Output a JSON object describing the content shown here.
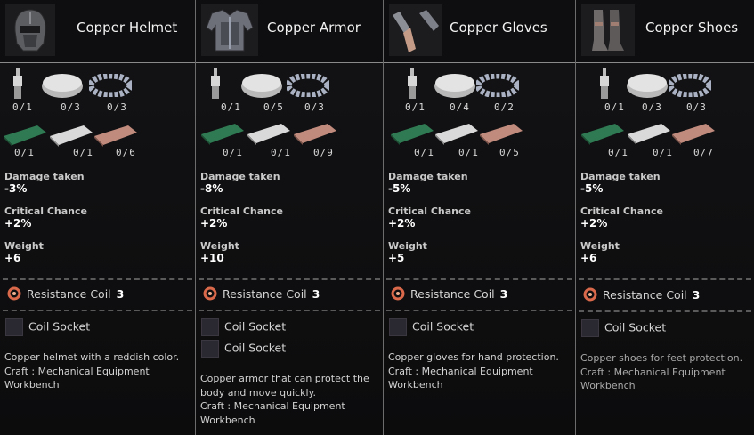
{
  "items": [
    {
      "name": "Copper Helmet",
      "materials": [
        "0/1",
        "0/3",
        "0/3",
        "0/1",
        "0/1",
        "0/6"
      ],
      "stats": [
        {
          "label": "Damage taken",
          "value": "-3%"
        },
        {
          "label": "Critical Chance",
          "value": "+2%"
        },
        {
          "label": "Weight",
          "value": "+6"
        }
      ],
      "coil_label": "Resistance Coil",
      "coil_count": "3",
      "sockets": [
        "Coil Socket"
      ],
      "desc": "Copper helmet with a reddish color.",
      "craft": "Craft : Mechanical Equipment Workbench"
    },
    {
      "name": "Copper Armor",
      "materials": [
        "0/1",
        "0/5",
        "0/3",
        "0/1",
        "0/1",
        "0/9"
      ],
      "stats": [
        {
          "label": "Damage taken",
          "value": "-8%"
        },
        {
          "label": "Critical Chance",
          "value": "+2%"
        },
        {
          "label": "Weight",
          "value": "+10"
        }
      ],
      "coil_label": "Resistance Coil",
      "coil_count": "3",
      "sockets": [
        "Coil Socket",
        "Coil Socket"
      ],
      "desc": "Copper armor that can protect the body and move quickly.",
      "craft": "Craft : Mechanical Equipment Workbench"
    },
    {
      "name": "Copper Gloves",
      "materials": [
        "0/1",
        "0/4",
        "0/2",
        "0/1",
        "0/1",
        "0/5"
      ],
      "stats": [
        {
          "label": "Damage taken",
          "value": "-5%"
        },
        {
          "label": "Critical Chance",
          "value": "+2%"
        },
        {
          "label": "Weight",
          "value": "+5"
        }
      ],
      "coil_label": "Resistance Coil",
      "coil_count": "3",
      "sockets": [
        "Coil Socket"
      ],
      "desc": "Copper gloves for hand protection.",
      "craft": "Craft : Mechanical Equipment Workbench"
    },
    {
      "name": "Copper Shoes",
      "materials": [
        "0/1",
        "0/3",
        "0/3",
        "0/1",
        "0/1",
        "0/7"
      ],
      "stats": [
        {
          "label": "Damage taken",
          "value": "-5%"
        },
        {
          "label": "Critical Chance",
          "value": "+2%"
        },
        {
          "label": "Weight",
          "value": "+6"
        }
      ],
      "coil_label": "Resistance Coil",
      "coil_count": "3",
      "sockets": [
        "Coil Socket"
      ],
      "desc": "Copper shoes for feet protection.",
      "craft": "Craft : Mechanical Equipment Workbench"
    }
  ],
  "colors": {
    "divider": "#8a8a8a",
    "green_ingot": "#2f7a52",
    "silver_ingot": "#d9d9d9",
    "copper_ingot": "#c08a7c",
    "coil_icon": "#d9694a"
  }
}
